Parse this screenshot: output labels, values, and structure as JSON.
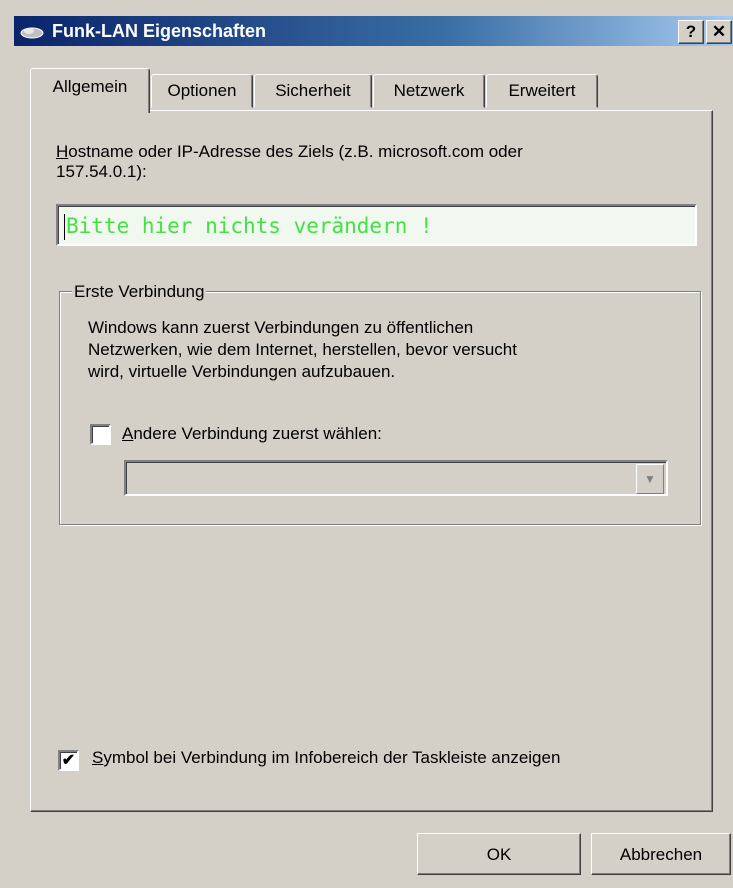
{
  "window": {
    "title": "Funk-LAN Eigenschaften",
    "help_button": "?",
    "close_button": "✕"
  },
  "tabs": [
    {
      "label": "Allgemein",
      "active": true
    },
    {
      "label": "Optionen",
      "active": false
    },
    {
      "label": "Sicherheit",
      "active": false
    },
    {
      "label": "Netzwerk",
      "active": false
    },
    {
      "label": "Erweitert",
      "active": false
    }
  ],
  "host": {
    "label_hotkey": "H",
    "label_line1_rest": "ostname oder IP-Adresse des Ziels (z.B. microsoft.com oder",
    "label_line2": "157.54.0.1):",
    "value": "Bitte hier nichts verändern !",
    "value_color": "#44e044"
  },
  "first_connection": {
    "title": "Erste Verbindung",
    "description_lines": [
      "Windows kann zuerst Verbindungen zu öffentlichen",
      "Netzwerken, wie dem Internet, herstellen, bevor versucht",
      "wird, virtuelle Verbindungen aufzubauen."
    ],
    "checkbox_hotkey": "A",
    "checkbox_label_rest": "ndere Verbindung zuerst wählen:",
    "checkbox_checked": false,
    "dropdown_value": ""
  },
  "tray_icon": {
    "hotkey": "S",
    "label_rest": "ymbol bei Verbindung im Infobereich der Taskleiste anzeigen",
    "checked": true,
    "check_glyph": "✔"
  },
  "buttons": {
    "ok": "OK",
    "cancel": "Abbrechen"
  }
}
